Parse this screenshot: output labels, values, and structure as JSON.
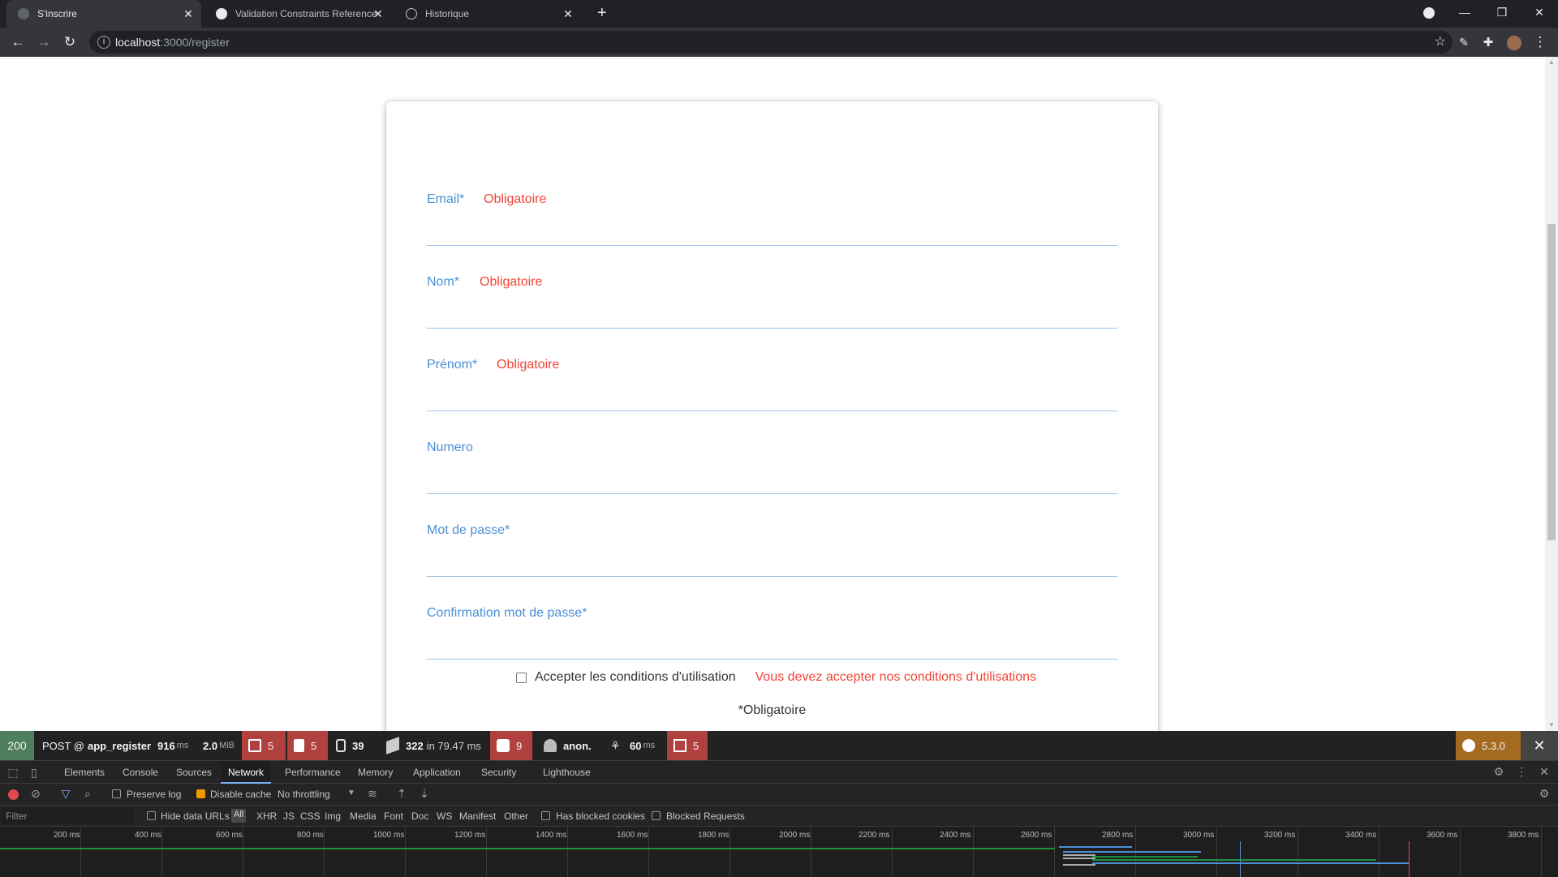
{
  "browser": {
    "tabs": [
      {
        "title": "S'inscrire",
        "active": true
      },
      {
        "title": "Validation Constraints Reference",
        "active": false
      },
      {
        "title": "Historique",
        "active": false
      }
    ],
    "url_host": "localhost",
    "url_path": ":3000/register"
  },
  "form": {
    "fields": [
      {
        "label": "Email*",
        "error": "Obligatoire"
      },
      {
        "label": "Nom*",
        "error": "Obligatoire"
      },
      {
        "label": "Prénom*",
        "error": "Obligatoire"
      },
      {
        "label": "Numero",
        "error": ""
      },
      {
        "label": "Mot de passe*",
        "error": ""
      },
      {
        "label": "Confirmation mot de passe*",
        "error": ""
      }
    ],
    "terms_label": "Accepter les conditions d'utilisation",
    "terms_error": "Vous devez accepter nos conditions d'utilisations",
    "required_note": "*Obligatoire"
  },
  "symfony_toolbar": {
    "status": "200",
    "method": "POST @ ",
    "route": "app_register",
    "time": "916",
    "time_unit": "ms",
    "memory": "2.0",
    "memory_unit": "MiB",
    "forms": "5",
    "validator": "5",
    "logs": "39",
    "cache_count": "322",
    "cache_time": "in 79.47 ms",
    "translations": "9",
    "user": "anon.",
    "twig_time": "60",
    "twig_unit": "ms",
    "requests": "5",
    "version": "5.3.0"
  },
  "devtools": {
    "tabs": [
      "Elements",
      "Console",
      "Sources",
      "Network",
      "Performance",
      "Memory",
      "Application",
      "Security",
      "Lighthouse"
    ],
    "active_tab": "Network",
    "preserve_log": "Preserve log",
    "disable_cache": "Disable cache",
    "throttling": "No throttling",
    "filter_placeholder": "Filter",
    "hide_data_urls": "Hide data URLs",
    "all": "All",
    "types": [
      "XHR",
      "JS",
      "CSS",
      "Img",
      "Media",
      "Font",
      "Doc",
      "WS",
      "Manifest",
      "Other"
    ],
    "has_blocked_cookies": "Has blocked cookies",
    "blocked_requests": "Blocked Requests",
    "timeline_ticks": [
      "200 ms",
      "400 ms",
      "600 ms",
      "800 ms",
      "1000 ms",
      "1200 ms",
      "1400 ms",
      "1600 ms",
      "1800 ms",
      "2000 ms",
      "2200 ms",
      "2400 ms",
      "2600 ms",
      "2800 ms",
      "3000 ms",
      "3200 ms",
      "3400 ms",
      "3600 ms",
      "3800 ms"
    ]
  },
  "colors": {
    "label_blue": "#4b8fd6",
    "error_red": "#f44336",
    "symfony_red": "#b0413e",
    "symfony_green": "#4f805d"
  }
}
